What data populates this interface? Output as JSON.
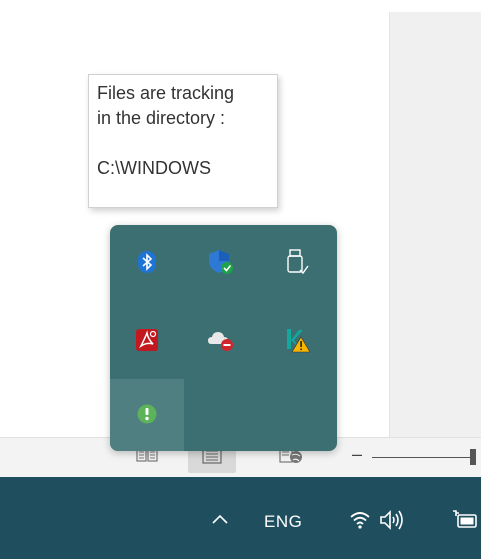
{
  "tooltip": {
    "line1": "Files are tracking",
    "line2": "in the directory :",
    "line3": "C:\\WINDOWS"
  },
  "statusbar": {
    "views": [
      "read-mode-icon",
      "print-layout-icon",
      "web-layout-icon"
    ],
    "zoom_minus": "–"
  },
  "tray_overflow": {
    "icons": [
      "bluetooth-icon",
      "windows-security-icon",
      "usb-safely-remove-icon",
      "adobe-acrobat-icon",
      "onedrive-icon",
      "kaspersky-warning-icon",
      "file-tracker-app-icon"
    ]
  },
  "taskbar": {
    "language": "ENG",
    "icons": [
      "show-hidden-icons-chevron",
      "wifi-icon",
      "volume-icon",
      "battery-icon"
    ]
  },
  "colors": {
    "taskbar_bg": "#1f4f5f",
    "tray_bg": "#3c6f71",
    "tray_hover": "#4f7f81",
    "bluetooth_blue": "#1e74d6",
    "security_check_green": "#1ea24a",
    "acrobat_red": "#c2181f",
    "onedrive_error_red": "#d0262b",
    "tracker_green": "#5db359"
  }
}
